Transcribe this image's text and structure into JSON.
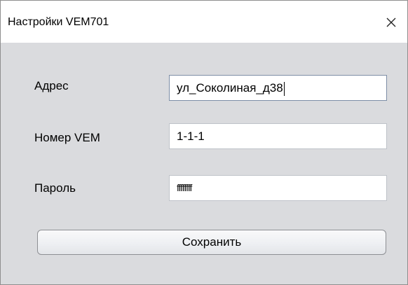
{
  "window": {
    "title": "Настройки VEM701",
    "close_icon": "close-icon"
  },
  "form": {
    "address": {
      "label": "Адрес",
      "value": "ул_Соколиная_д38"
    },
    "vem_number": {
      "label": "Номер VEM",
      "value": "1-1-1"
    },
    "password": {
      "label": "Пароль",
      "value": "ffffffff"
    }
  },
  "buttons": {
    "save_label": "Сохранить"
  },
  "colors": {
    "client_background": "#dadbde",
    "titlebar_background": "#ffffff",
    "field_border": "#bfc3c9"
  }
}
